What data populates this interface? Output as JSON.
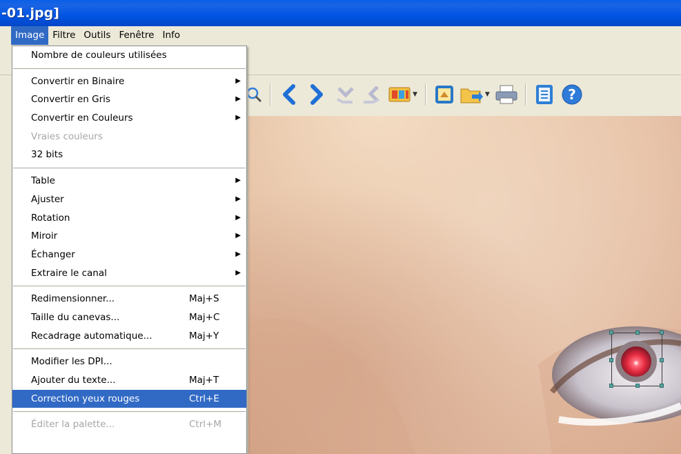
{
  "window": {
    "title": "-01.jpg]"
  },
  "menubar": {
    "items": [
      "Image",
      "Filtre",
      "Outils",
      "Fenêtre",
      "Info"
    ],
    "active": "Image"
  },
  "image_menu": {
    "groups": [
      [
        {
          "label": "Nombre de couleurs utilisées",
          "shortcut": "",
          "submenu": false,
          "disabled": false
        }
      ],
      [
        {
          "label": "Convertir en Binaire",
          "shortcut": "",
          "submenu": true,
          "disabled": false
        },
        {
          "label": "Convertir en Gris",
          "shortcut": "",
          "submenu": true,
          "disabled": false
        },
        {
          "label": "Convertir en Couleurs",
          "shortcut": "",
          "submenu": true,
          "disabled": false
        },
        {
          "label": "Vraies couleurs",
          "shortcut": "",
          "submenu": false,
          "disabled": true
        },
        {
          "label": "32 bits",
          "shortcut": "",
          "submenu": false,
          "disabled": false
        }
      ],
      [
        {
          "label": "Table",
          "shortcut": "",
          "submenu": true,
          "disabled": false
        },
        {
          "label": "Ajuster",
          "shortcut": "",
          "submenu": true,
          "disabled": false
        },
        {
          "label": "Rotation",
          "shortcut": "",
          "submenu": true,
          "disabled": false
        },
        {
          "label": "Miroir",
          "shortcut": "",
          "submenu": true,
          "disabled": false
        },
        {
          "label": "Échanger",
          "shortcut": "",
          "submenu": true,
          "disabled": false
        },
        {
          "label": "Extraire le canal",
          "shortcut": "",
          "submenu": true,
          "disabled": false
        }
      ],
      [
        {
          "label": "Redimensionner...",
          "shortcut": "Maj+S",
          "submenu": false,
          "disabled": false
        },
        {
          "label": "Taille du canevas...",
          "shortcut": "Maj+C",
          "submenu": false,
          "disabled": false
        },
        {
          "label": "Recadrage automatique...",
          "shortcut": "Maj+Y",
          "submenu": false,
          "disabled": false
        }
      ],
      [
        {
          "label": "Modifier les DPI...",
          "shortcut": "",
          "submenu": false,
          "disabled": false
        },
        {
          "label": "Ajouter du texte...",
          "shortcut": "Maj+T",
          "submenu": false,
          "disabled": false
        },
        {
          "label": "Correction yeux rouges",
          "shortcut": "Ctrl+E",
          "submenu": false,
          "disabled": false,
          "highlighted": true
        }
      ],
      [
        {
          "label": "Éditer la palette...",
          "shortcut": "Ctrl+M",
          "submenu": false,
          "disabled": true
        }
      ]
    ]
  },
  "toolbar": {
    "buttons": [
      "zoom-icon",
      "previous-arrow-icon",
      "next-arrow-icon",
      "previous-disabled-icon",
      "next-disabled-icon",
      "slideshow-icon",
      "fit-window-icon",
      "open-folder-icon",
      "print-icon",
      "properties-icon",
      "help-icon"
    ]
  },
  "colors": {
    "title_bar": "#0054e3",
    "menu_highlight": "#316ac5",
    "help_blue": "#2f7bd8",
    "skin": "#e8c6ae"
  }
}
